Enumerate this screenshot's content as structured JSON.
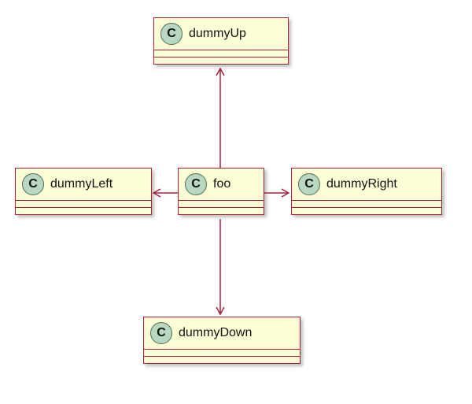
{
  "diagram": {
    "type": "uml-class-diagram",
    "stereotype_letter": "C",
    "classes": {
      "up": {
        "name": "dummyUp"
      },
      "left": {
        "name": "dummyLeft"
      },
      "center": {
        "name": "foo"
      },
      "right": {
        "name": "dummyRight"
      },
      "down": {
        "name": "dummyDown"
      }
    },
    "relations": [
      {
        "from": "foo",
        "to": "dummyUp",
        "direction": "up",
        "style": "open-arrow"
      },
      {
        "from": "foo",
        "to": "dummyLeft",
        "direction": "left",
        "style": "open-arrow"
      },
      {
        "from": "foo",
        "to": "dummyRight",
        "direction": "right",
        "style": "open-arrow"
      },
      {
        "from": "foo",
        "to": "dummyDown",
        "direction": "down",
        "style": "open-arrow"
      }
    ],
    "colors": {
      "fill": "#fdfdd6",
      "border": "#a8203b",
      "icon_fill": "#b9d8c2",
      "icon_border": "#4b7055",
      "arrow": "#a8203b"
    }
  }
}
